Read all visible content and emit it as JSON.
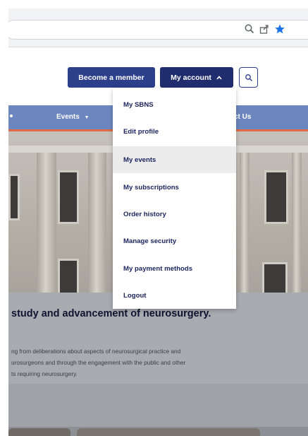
{
  "browser": {
    "icons": [
      "search-icon",
      "share-icon",
      "star-icon"
    ]
  },
  "header": {
    "become_member": "Become a member",
    "my_account": "My account",
    "search_icon": "search-icon"
  },
  "nav": {
    "items": [
      "Events",
      "ct Us"
    ]
  },
  "account_menu": {
    "items": [
      "My SBNS",
      "Edit profile",
      "My events",
      "My subscriptions",
      "Order history",
      "Manage security",
      "My payment methods",
      "Logout"
    ],
    "highlighted": "My events"
  },
  "hero": {
    "headline": "study and advancement of neurosurgery.",
    "paragraph_lines": [
      "ng from deliberations about aspects of neurosurgical practice and",
      "urosurgeons and through the engagement with the public and other",
      "ts requiring neurosurgery."
    ]
  },
  "colors": {
    "brand_dark": "#1f2c6e",
    "brand": "#2b3f8a",
    "nav": "#6c87bf",
    "nav_accent": "#e06b45"
  }
}
